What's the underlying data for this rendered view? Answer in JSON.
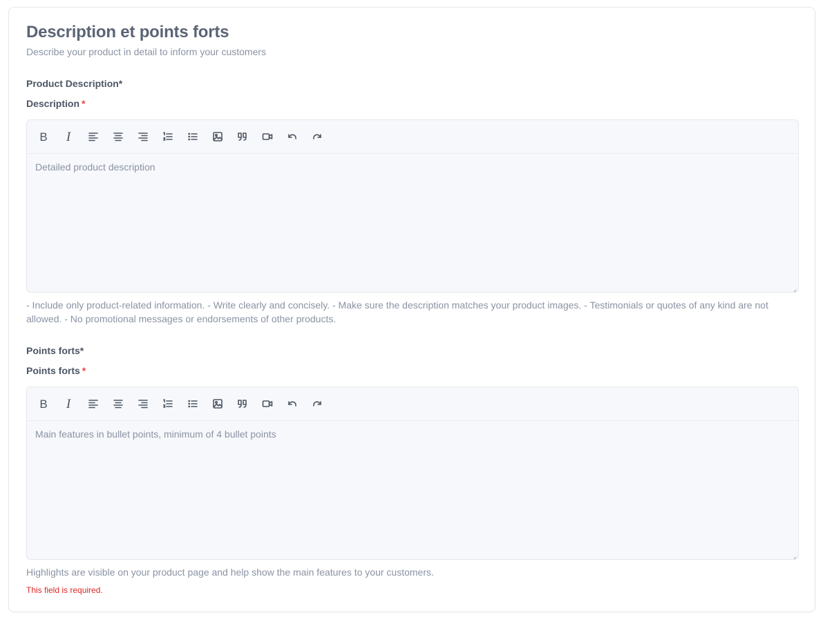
{
  "card": {
    "title": "Description et points forts",
    "subtitle": "Describe your product in detail to inform your customers"
  },
  "description": {
    "section_label": "Product Description*",
    "field_label": "Description",
    "required_mark": "*",
    "placeholder": "Detailed product description",
    "help": "- Include only product-related information. - Write clearly and concisely. - Make sure the description matches your product images. - Testimonials or quotes of any kind are not allowed. - No promotional messages or endorsements of other products."
  },
  "highlights": {
    "section_label": "Points forts*",
    "field_label": "Points forts",
    "required_mark": "*",
    "placeholder": "Main features in bullet points, minimum of 4 bullet points",
    "help": "Highlights are visible on your product page and help show the main features to your customers.",
    "error": "This field is required."
  },
  "toolbar": {
    "bold_glyph": "B",
    "italic_glyph": "I",
    "icons": [
      "bold-icon",
      "italic-icon",
      "align-left-icon",
      "align-center-icon",
      "align-right-icon",
      "ordered-list-icon",
      "bullet-list-icon",
      "image-icon",
      "quote-icon",
      "video-icon",
      "undo-icon",
      "redo-icon"
    ]
  },
  "colors": {
    "title": "#5b6475",
    "muted": "#8a93a3",
    "required": "#ef4444",
    "error": "#dc2626",
    "editor_bg": "#f7f8fb",
    "border": "#e5e7eb"
  }
}
